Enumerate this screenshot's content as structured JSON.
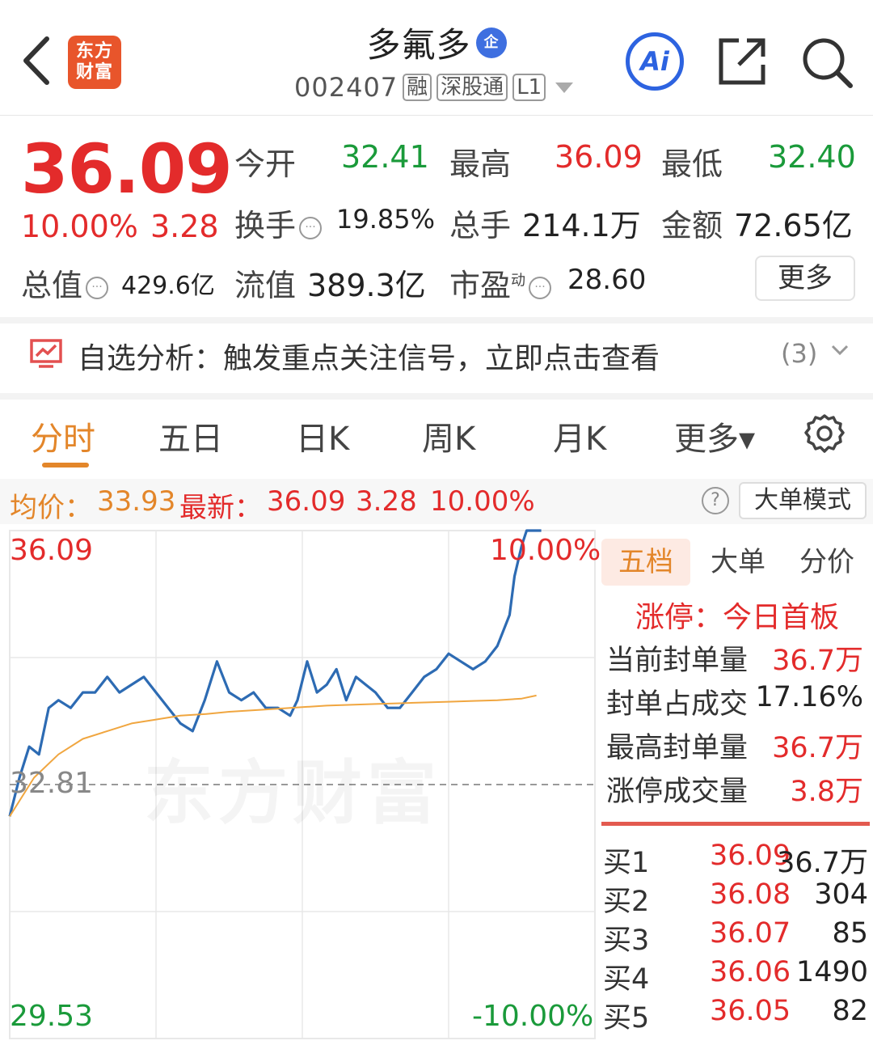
{
  "header": {
    "logo_text": "东方财富",
    "stock_name": "多氟多",
    "qi_badge": "企",
    "stock_code": "002407",
    "tags": [
      "融",
      "深股通",
      "L1"
    ],
    "ai_label": "Ai"
  },
  "quote": {
    "price": "36.09",
    "change_pct": "10.00%",
    "change_val": "3.28",
    "open_label": "今开",
    "open": "32.41",
    "high_label": "最高",
    "high": "36.09",
    "low_label": "最低",
    "low": "32.40",
    "turnover_label": "换手",
    "turnover": "19.85%",
    "volume_label": "总手",
    "volume": "214.1万",
    "amount_label": "金额",
    "amount": "72.65亿",
    "total_mv_label": "总值",
    "total_mv": "429.6亿",
    "float_mv_label": "流值",
    "float_mv": "389.3亿",
    "pe_label": "市盈",
    "pe_sup": "动",
    "pe": "28.60",
    "more_label": "更多"
  },
  "alert": {
    "text": "自选分析：触发重点关注信号，立即点击查看",
    "count": "(3)"
  },
  "tabs": [
    "分时",
    "五日",
    "日K",
    "周K",
    "月K",
    "更多▾"
  ],
  "infobar": {
    "avg_label": "均价：",
    "avg": "33.93",
    "latest_label": "最新：",
    "latest": "36.09",
    "chg": "3.28",
    "pct": "10.00%",
    "mode_button": "大单模式",
    "help": "?"
  },
  "chart_labels": {
    "top_price": "36.09",
    "top_pct": "10.00%",
    "mid_price": "32.81",
    "bottom_price": "29.53",
    "bottom_pct": "-10.00%",
    "watermark": "东方财富"
  },
  "chart_data": {
    "type": "line",
    "ylim": [
      29.53,
      36.09
    ],
    "x_range": [
      0,
      240
    ],
    "series": [
      {
        "x": [
          0,
          4,
          8,
          12,
          16,
          20,
          25,
          30,
          35,
          40,
          45,
          50,
          55,
          60,
          65,
          70,
          75,
          80,
          85,
          90,
          95,
          100,
          105,
          110,
          115,
          118,
          122,
          126,
          130,
          134,
          138,
          142,
          146,
          150,
          155,
          160,
          165,
          170,
          175,
          180,
          185,
          190,
          195,
          200,
          205,
          207,
          210,
          212,
          214,
          216,
          218
        ],
        "values": [
          32.4,
          32.9,
          33.3,
          33.2,
          33.8,
          33.9,
          33.8,
          34.0,
          34.0,
          34.2,
          34.0,
          34.1,
          34.2,
          34.0,
          33.8,
          33.6,
          33.5,
          33.9,
          34.4,
          34.0,
          33.9,
          34.0,
          33.8,
          33.8,
          33.7,
          33.9,
          34.4,
          34.0,
          34.1,
          34.3,
          33.9,
          34.2,
          34.1,
          34.0,
          33.8,
          33.8,
          34.0,
          34.2,
          34.3,
          34.5,
          34.4,
          34.3,
          34.4,
          34.6,
          35.0,
          35.5,
          35.9,
          36.09,
          36.09,
          36.09,
          36.09
        ]
      },
      {
        "x": [
          0,
          10,
          20,
          30,
          40,
          50,
          60,
          70,
          80,
          90,
          100,
          110,
          120,
          130,
          140,
          150,
          160,
          170,
          180,
          190,
          200,
          210,
          216
        ],
        "values": [
          32.4,
          32.9,
          33.2,
          33.4,
          33.5,
          33.6,
          33.65,
          33.7,
          33.72,
          33.75,
          33.77,
          33.79,
          33.81,
          33.83,
          33.84,
          33.85,
          33.86,
          33.87,
          33.88,
          33.89,
          33.9,
          33.92,
          33.96
        ]
      }
    ],
    "colors": {
      "price": "#2d6bb3",
      "avg": "#f0a640",
      "grid": "#e8e8e8",
      "baseline": "#999999"
    }
  },
  "panel": {
    "tabs": [
      "五档",
      "大单",
      "分价"
    ],
    "limit_title": "涨停：今日首板",
    "stats": [
      {
        "label": "当前封单量",
        "value": "36.7万",
        "red": true
      },
      {
        "label": "封单占成交",
        "value": "17.16%",
        "red": false
      },
      {
        "label": "最高封单量",
        "value": "36.7万",
        "red": true
      },
      {
        "label": "涨停成交量",
        "value": "3.8万",
        "red": true
      }
    ],
    "bids": [
      {
        "label": "买1",
        "price": "36.09",
        "vol": "36.7万"
      },
      {
        "label": "买2",
        "price": "36.08",
        "vol": "304"
      },
      {
        "label": "买3",
        "price": "36.07",
        "vol": "85"
      },
      {
        "label": "买4",
        "price": "36.06",
        "vol": "1490"
      },
      {
        "label": "买5",
        "price": "36.05",
        "vol": "82"
      }
    ]
  }
}
